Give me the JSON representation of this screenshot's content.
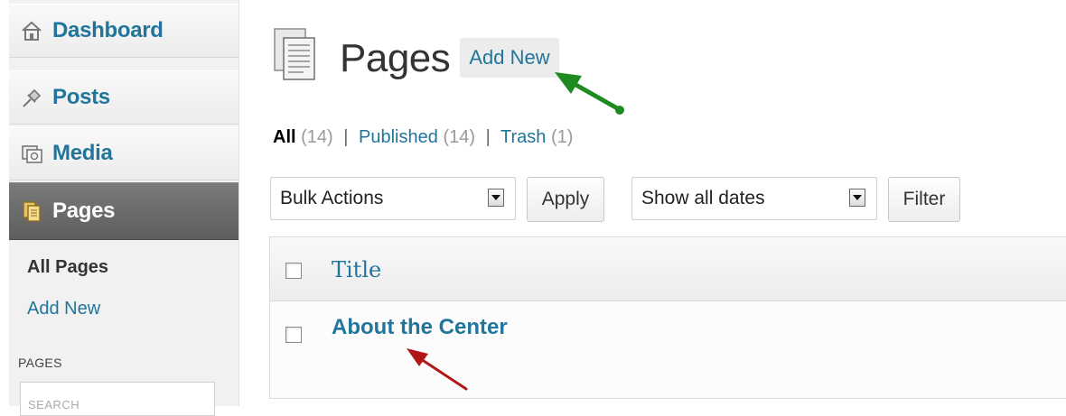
{
  "sidebar": {
    "items": [
      {
        "label": "Dashboard",
        "icon": "dashboard-icon"
      },
      {
        "label": "Posts",
        "icon": "pushpin-icon"
      },
      {
        "label": "Media",
        "icon": "media-icon"
      },
      {
        "label": "Pages",
        "icon": "pages-icon",
        "active": true
      }
    ],
    "submenu": [
      "All Pages",
      "Add New"
    ],
    "widget_title": "PAGES",
    "search_placeholder": "SEARCH"
  },
  "header": {
    "title": "Pages",
    "add_new_label": "Add New"
  },
  "filters": {
    "all_label": "All",
    "all_count": "(14)",
    "published_label": "Published",
    "published_count": "(14)",
    "trash_label": "Trash",
    "trash_count": "(1)",
    "separator": "|"
  },
  "actions": {
    "bulk_select_value": "Bulk Actions",
    "apply_label": "Apply",
    "dates_select_value": "Show all dates",
    "filter_label": "Filter"
  },
  "table": {
    "column_title": "Title",
    "rows": [
      {
        "title": "About the Center"
      }
    ]
  },
  "colors": {
    "link": "#21759b",
    "active_menu": "#6a6a6a",
    "green_arrow": "#1f8a1f",
    "red_arrow": "#b01818"
  }
}
